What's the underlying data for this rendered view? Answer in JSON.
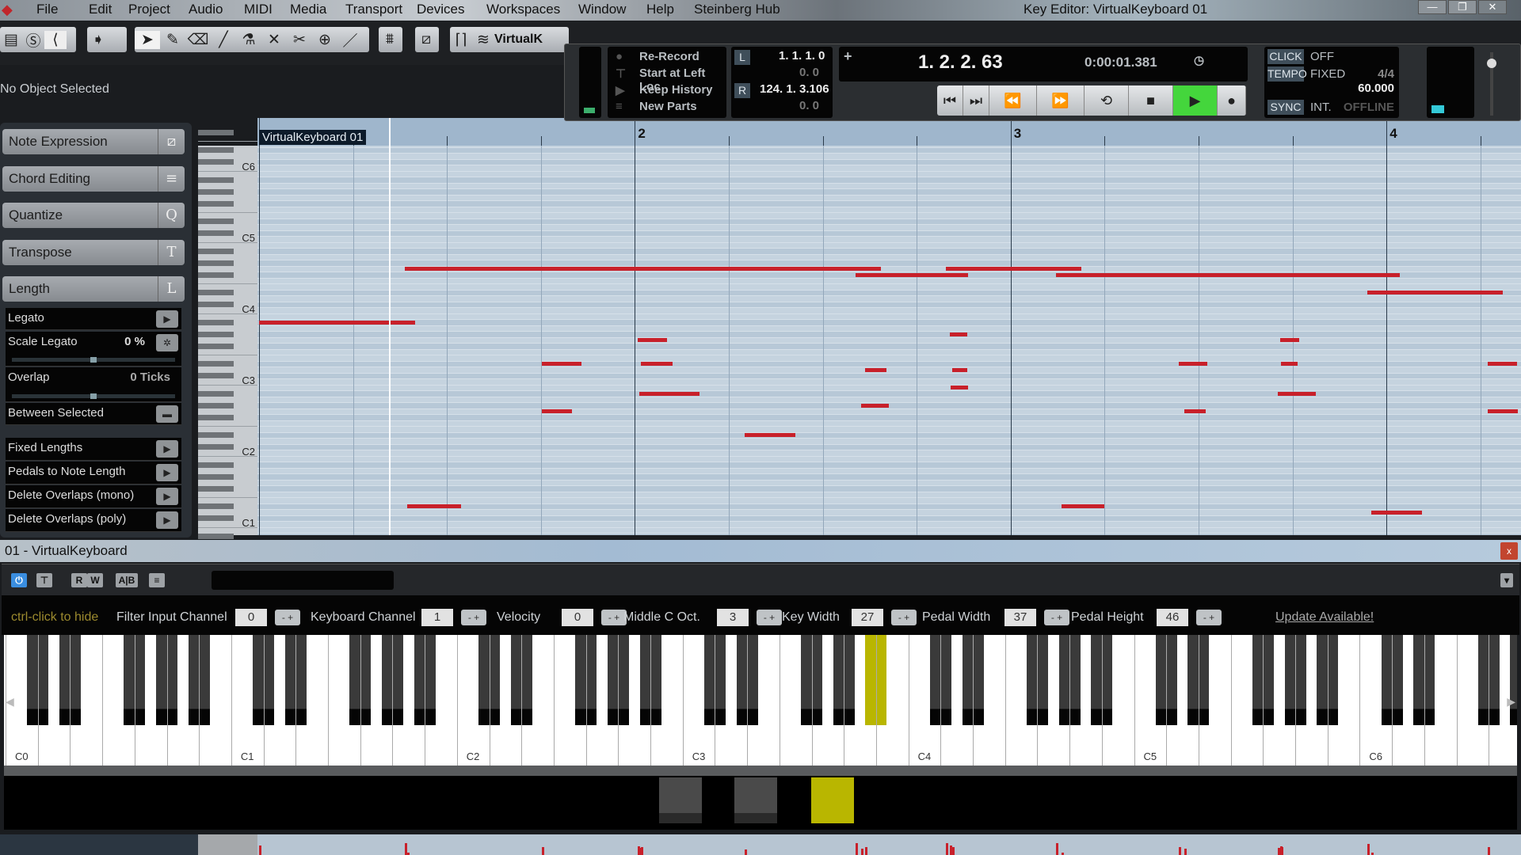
{
  "window": {
    "title": "Key Editor: VirtualKeyboard 01",
    "controls": [
      "—",
      "❐",
      "✕"
    ]
  },
  "menu": [
    "File",
    "Edit",
    "Project",
    "Audio",
    "MIDI",
    "Media",
    "Transport",
    "Devices",
    "Workspaces",
    "Window",
    "Help",
    "Steinberg Hub"
  ],
  "toolbar": {
    "track_name": "VirtualK",
    "tools": [
      "select-icon",
      "draw-icon",
      "erase-icon",
      "line-icon",
      "glue-icon",
      "mute-x-icon",
      "split-icon",
      "zoom-icon",
      "line-draw-icon"
    ]
  },
  "info_line": "No Object Selected",
  "left_panel": {
    "sections": [
      {
        "label": "Note Expression",
        "icon": "⧄"
      },
      {
        "label": "Chord Editing",
        "icon": "≡"
      },
      {
        "label": "Quantize",
        "icon": "Q"
      },
      {
        "label": "Transpose",
        "icon": "T"
      },
      {
        "label": "Length",
        "icon": "L"
      }
    ],
    "length": {
      "legato": "Legato",
      "scale_legato": "Scale Legato",
      "scale_legato_value": "0 %",
      "scale_legato_level": 0.5,
      "overlap": "Overlap",
      "overlap_value": "0 Ticks",
      "overlap_level": 0.5,
      "between_selected": "Between Selected"
    },
    "functions": [
      "Fixed Lengths",
      "Pedals to Note Length",
      "Delete Overlaps (mono)",
      "Delete Overlaps (poly)"
    ]
  },
  "editor": {
    "part_name": "VirtualKeyboard 01",
    "bar_labels": [
      "2",
      "3",
      "4"
    ],
    "pitch_labels": [
      "C6",
      "C5",
      "C4",
      "C3",
      "C2",
      "C1"
    ],
    "note_color": "#c8202a",
    "playhead_beat": 1.38,
    "notes": [
      {
        "pitch": 58,
        "start": 0,
        "end": 1.66
      },
      {
        "pitch": 67,
        "start": 1.55,
        "end": 6.62
      },
      {
        "pitch": 66,
        "start": 6.35,
        "end": 7.55
      },
      {
        "pitch": 67,
        "start": 7.31,
        "end": 8.75
      },
      {
        "pitch": 66,
        "start": 8.48,
        "end": 12.14
      },
      {
        "pitch": 63,
        "start": 11.8,
        "end": 13.24
      },
      {
        "pitch": 27,
        "start": 1.58,
        "end": 2.15
      },
      {
        "pitch": 51,
        "start": 3.01,
        "end": 3.43
      },
      {
        "pitch": 43,
        "start": 3.01,
        "end": 3.33
      },
      {
        "pitch": 55,
        "start": 4.03,
        "end": 4.34
      },
      {
        "pitch": 51,
        "start": 4.06,
        "end": 4.4
      },
      {
        "pitch": 46,
        "start": 4.05,
        "end": 4.69
      },
      {
        "pitch": 39,
        "start": 5.17,
        "end": 5.71
      },
      {
        "pitch": 50,
        "start": 6.45,
        "end": 6.68
      },
      {
        "pitch": 44,
        "start": 6.41,
        "end": 6.7
      },
      {
        "pitch": 56,
        "start": 7.35,
        "end": 7.54
      },
      {
        "pitch": 50,
        "start": 7.38,
        "end": 7.54
      },
      {
        "pitch": 47,
        "start": 7.36,
        "end": 7.55
      },
      {
        "pitch": 27,
        "start": 8.54,
        "end": 9.0
      },
      {
        "pitch": 51,
        "start": 9.79,
        "end": 10.09
      },
      {
        "pitch": 43,
        "start": 9.85,
        "end": 10.08
      },
      {
        "pitch": 55,
        "start": 10.87,
        "end": 11.07
      },
      {
        "pitch": 51,
        "start": 10.88,
        "end": 11.05
      },
      {
        "pitch": 46,
        "start": 10.84,
        "end": 11.25
      },
      {
        "pitch": 26,
        "start": 11.84,
        "end": 12.38
      },
      {
        "pitch": 51,
        "start": 13.08,
        "end": 13.39
      },
      {
        "pitch": 43,
        "start": 13.08,
        "end": 13.4
      }
    ]
  },
  "transport": {
    "record_modes": [
      "Re-Record",
      "Start at Left Loc",
      "Keep History",
      "New Parts"
    ],
    "left_locator": "1. 1. 1. 0",
    "left_offset": "0. 0",
    "right_locator": "124. 1. 3.106",
    "right_offset": "0. 0",
    "locator_tags": [
      "L",
      "R"
    ],
    "position": "1. 2. 2. 63",
    "time": "0:00:01.381",
    "buttons": [
      "go-to-start",
      "go-to-end",
      "rewind",
      "fast-forward",
      "cycle",
      "stop",
      "play",
      "record"
    ],
    "play_active_color": "#44d63c",
    "click_tag": "CLICK",
    "click_value": "OFF",
    "tempo_tag": "TEMPO",
    "tempo_mode": "FIXED",
    "signature": "4/4",
    "tempo": "60.000",
    "sync_tag": "SYNC",
    "sync_mode": "INT.",
    "sync_state": "OFFLINE"
  },
  "virtual_keyboard": {
    "title": "01 - VirtualKeyboard",
    "close": "x",
    "toolbar_buttons": [
      "⏻",
      "⊤",
      "R",
      "W",
      "A|B",
      "≡"
    ],
    "hint": "ctrl-click to hide",
    "params": [
      {
        "label": "Filter Input Channel",
        "value": "0"
      },
      {
        "label": "Keyboard Channel",
        "value": "1"
      },
      {
        "label": "Velocity",
        "value": "0"
      },
      {
        "label": "Middle C Oct.",
        "value": "3"
      },
      {
        "label": "Key Width",
        "value": "27"
      },
      {
        "label": "Pedal Width",
        "value": "37"
      },
      {
        "label": "Pedal Height",
        "value": "46"
      }
    ],
    "update_link": "Update Available!",
    "octave_labels": [
      "C0",
      "C1",
      "C2",
      "C3",
      "C4",
      "C5",
      "C6"
    ],
    "pressed_key": "A#3",
    "pressed_color": "#b9b600",
    "pedals": [
      {
        "active": false
      },
      {
        "active": false
      },
      {
        "active": true
      }
    ]
  }
}
